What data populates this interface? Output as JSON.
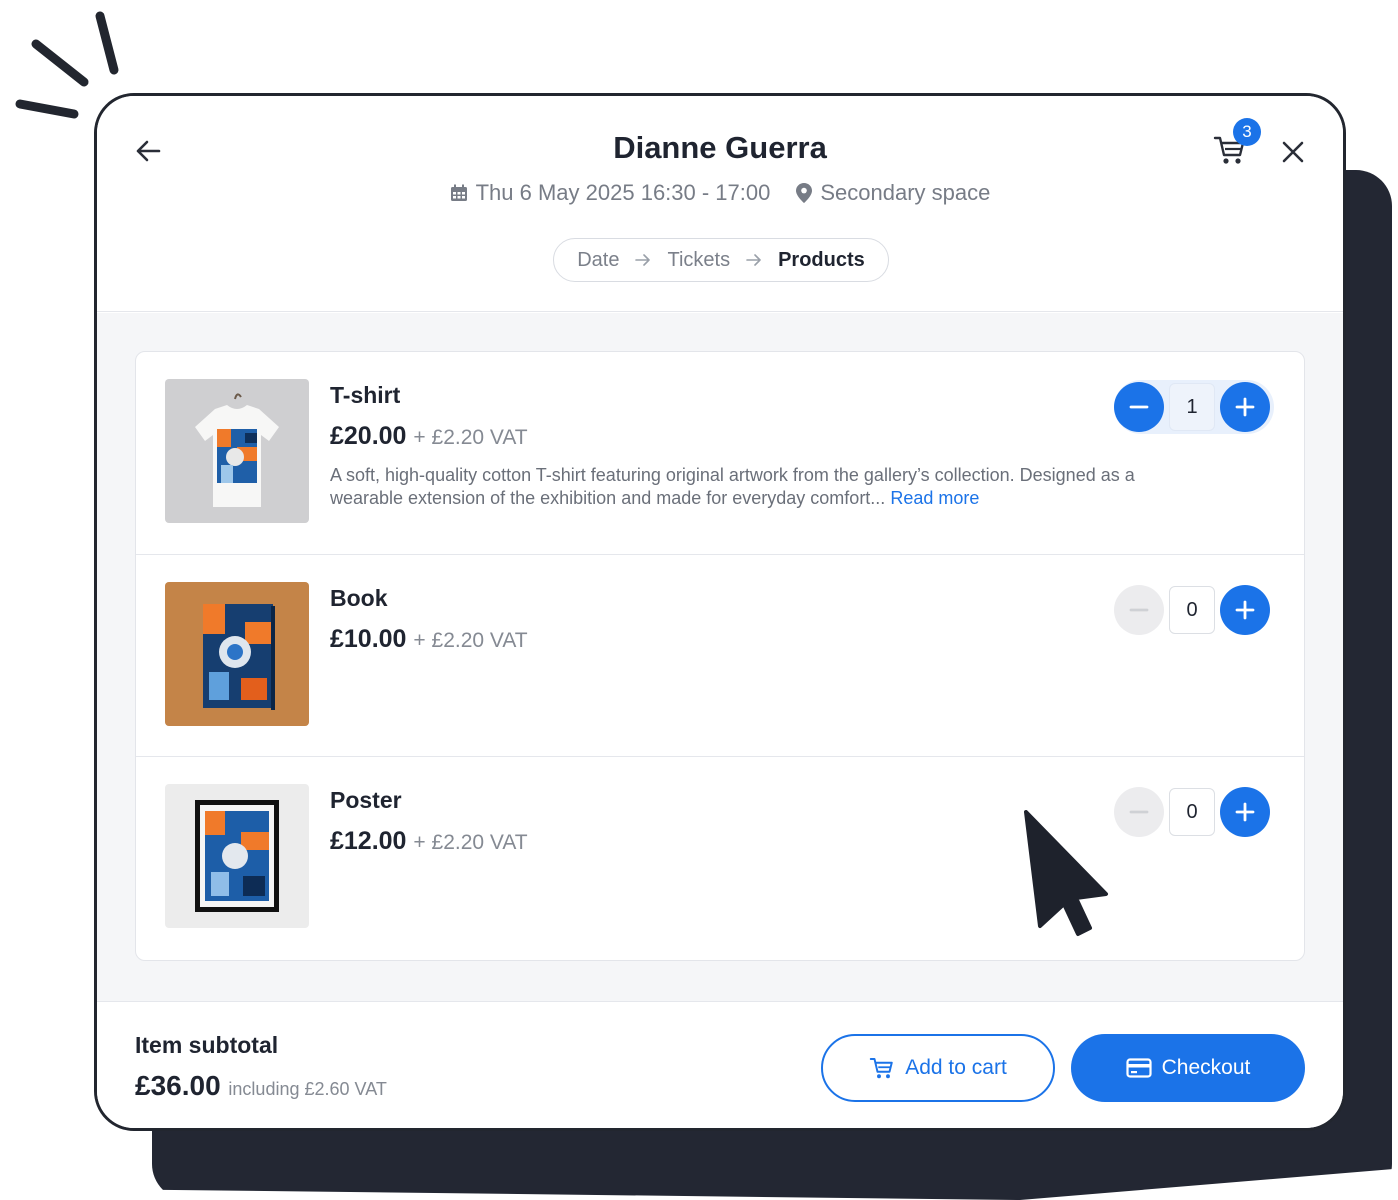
{
  "header": {
    "title": "Dianne Guerra",
    "datetime": "Thu 6 May 2025 16:30 - 17:00",
    "location": "Secondary space",
    "cart_count": "3",
    "steps": [
      "Date",
      "Tickets",
      "Products"
    ],
    "active_step": "Products"
  },
  "products": [
    {
      "name": "T-shirt",
      "price": "£20.00",
      "vat": "+ £2.20 VAT",
      "description": "A soft, high-quality cotton T-shirt featuring original artwork from the gallery’s collection. Designed as a wearable extension of the exhibition and made for everyday comfort...",
      "read_more": "Read more",
      "quantity": "1"
    },
    {
      "name": "Book",
      "price": "£10.00",
      "vat": "+ £2.20 VAT",
      "quantity": "0"
    },
    {
      "name": "Poster",
      "price": "£12.00",
      "vat": "+ £2.20 VAT",
      "quantity": "0"
    }
  ],
  "footer": {
    "subtotal_label": "Item subtotal",
    "subtotal_value": "£36.00",
    "subtotal_vat": "including £2.60 VAT",
    "add_to_cart_label": "Add to cart",
    "checkout_label": "Checkout"
  },
  "colors": {
    "accent": "#1b73e8",
    "frame": "#22262f",
    "muted_text": "#777c86"
  },
  "icons": [
    "back-arrow-icon",
    "cart-icon",
    "close-icon",
    "calendar-icon",
    "location-pin-icon",
    "arrow-right-icon",
    "minus-icon",
    "plus-icon",
    "credit-card-icon",
    "mouse-pointer-icon"
  ]
}
